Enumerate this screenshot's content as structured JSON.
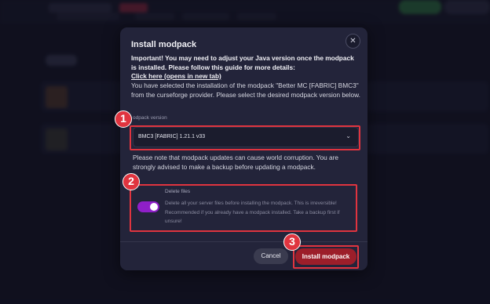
{
  "modal": {
    "title": "Install modpack",
    "close_glyph": "✕",
    "warning": "Important! You may need to adjust your Java version once the modpack is installed. Please follow this guide for more details:",
    "link_text": "Click here (opens in new tab)",
    "description": "You have selected the installation of the modpack \"Better MC [FABRIC] BMC3\" from the curseforge provider. Please select the desired modpack version below.",
    "version_label": "odpack version",
    "version_value": "BMC3 [FABRIC] 1.21.1 v33",
    "chevron_glyph": "⌄",
    "note": "Please note that modpack updates can cause world corruption. You are strongly advised to make a backup before updating a modpack.",
    "delete_files": {
      "label": "Delete files",
      "description": "Delete all your server files before installing the modpack. This is irreversible! Recommended if you already have a modpack installed. Take a backup first if unsure!",
      "enabled": true
    },
    "cancel_label": "Cancel",
    "install_label": "Install modpack"
  },
  "annotations": [
    "1",
    "2",
    "3"
  ],
  "colors": {
    "accent_red": "#e0343f",
    "toggle_on": "#8f1fc8",
    "install_button": "#9c1e2a"
  }
}
